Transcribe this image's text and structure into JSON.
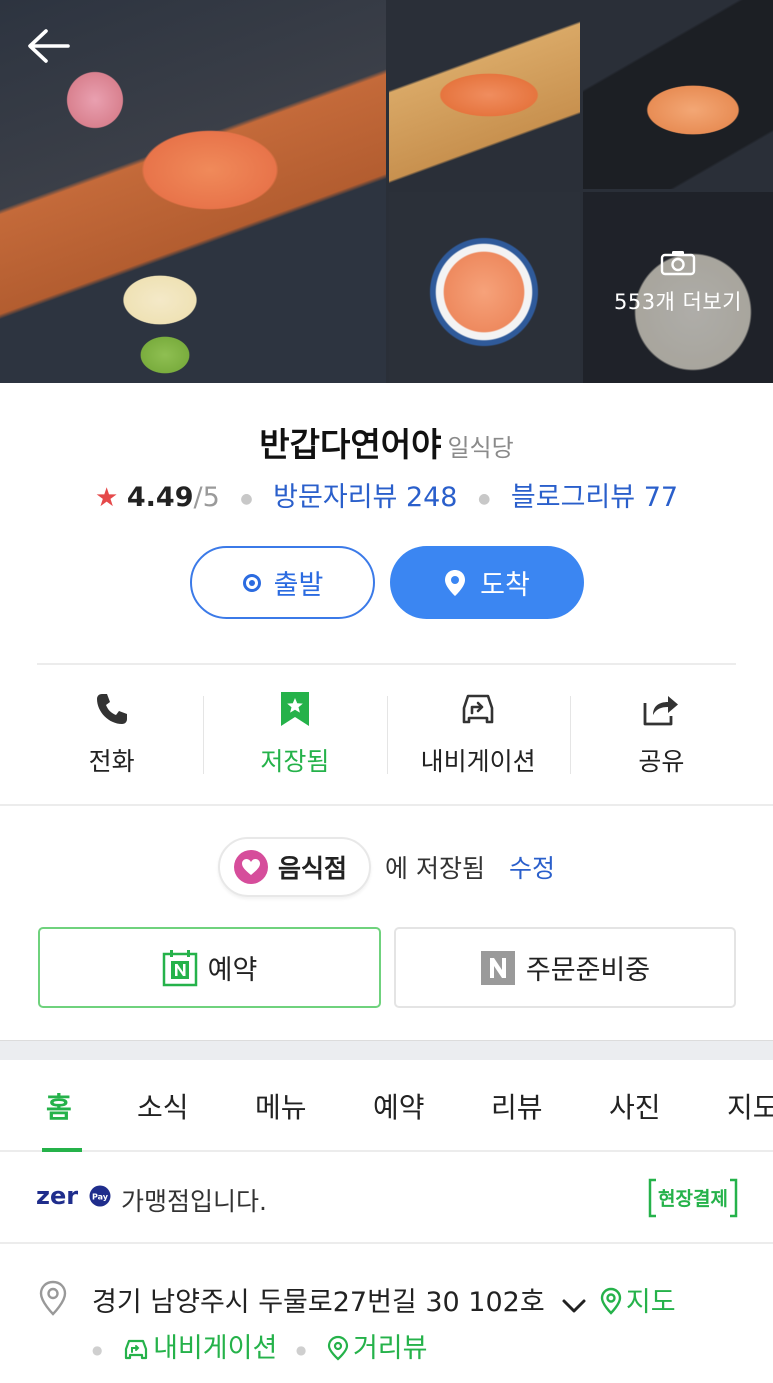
{
  "photos": {
    "more_label": "553개 더보기"
  },
  "place": {
    "name": "반갑다연어야",
    "category": "일식당",
    "rating": "4.49",
    "rating_max": "/5",
    "visitor_reviews": "방문자리뷰 248",
    "blog_reviews": "블로그리뷰 77"
  },
  "route": {
    "departure_label": "출발",
    "arrival_label": "도착"
  },
  "actions": [
    {
      "label": "전화",
      "icon": "phone-icon"
    },
    {
      "label": "저장됨",
      "icon": "bookmark-star-icon"
    },
    {
      "label": "내비게이션",
      "icon": "car-navigation-icon"
    },
    {
      "label": "공유",
      "icon": "share-icon"
    }
  ],
  "saved": {
    "folder": "음식점",
    "text": "에 저장됨",
    "edit_label": "수정"
  },
  "booking": {
    "reserve_label": "예약",
    "order_label": "주문준비중"
  },
  "tabs": [
    "홈",
    "소식",
    "메뉴",
    "예약",
    "리뷰",
    "사진",
    "지도"
  ],
  "active_tab": "홈",
  "zeropay": {
    "logo_text": "zero",
    "logo_sub": "Pay",
    "text": "가맹점입니다.",
    "badge": "현장결제"
  },
  "address": {
    "text": "경기 남양주시 두물로27번길 30 102호",
    "map_label": "지도",
    "navigation_label": "내비게이션",
    "street_view_label": "거리뷰"
  },
  "colors": {
    "accent_green": "#25b24a",
    "link_blue": "#2a5fcb",
    "button_blue": "#3b86f2",
    "star_red": "#e5494a"
  }
}
